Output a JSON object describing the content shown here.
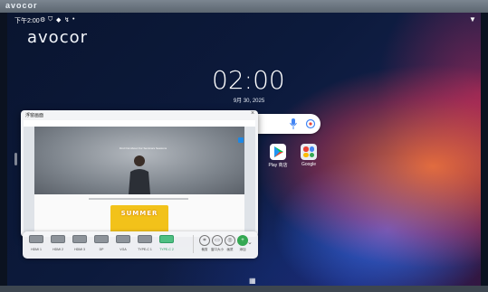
{
  "bezel": {
    "brand": "avocor"
  },
  "status_bar": {
    "time": "下午2:00",
    "icons": [
      "settings-icon",
      "shield-icon",
      "vpn-icon",
      "location-icon",
      "dot-icon"
    ],
    "wifi": "wifi-icon"
  },
  "home": {
    "logo": "avocor",
    "clock": "02:00",
    "date": "9月 30, 2025"
  },
  "search": {
    "icons": [
      "google-g-icon",
      "mic-icon",
      "lens-icon"
    ]
  },
  "apps": [
    {
      "label": "Play 商店",
      "icon": "play-store-icon"
    },
    {
      "label": "Google",
      "icon": "google-apps-icon"
    }
  ],
  "window": {
    "title": "浮窗画面",
    "close": "×",
    "web": {
      "headline": "Find Out About Our Seminars Sessions",
      "summer": "SUMMER"
    }
  },
  "toolbar": {
    "sources": [
      {
        "label": "HDMI 1",
        "active": false
      },
      {
        "label": "HDMI 2",
        "active": false
      },
      {
        "label": "HDMI 3",
        "active": false
      },
      {
        "label": "DP",
        "active": false
      },
      {
        "label": "VGA",
        "active": false
      },
      {
        "label": "TYPE-C 1",
        "active": false
      },
      {
        "label": "TYPE-C 2",
        "active": true
      }
    ],
    "tools": [
      {
        "label": "裁剪",
        "icon": "crop-icon"
      },
      {
        "label": "窗口大小",
        "icon": "resize-icon"
      },
      {
        "label": "画质",
        "icon": "quality-icon"
      },
      {
        "label": "添加",
        "icon": "add-icon"
      }
    ]
  },
  "colors": {
    "accent": "#34a853",
    "active_source": "#4fbf82"
  }
}
